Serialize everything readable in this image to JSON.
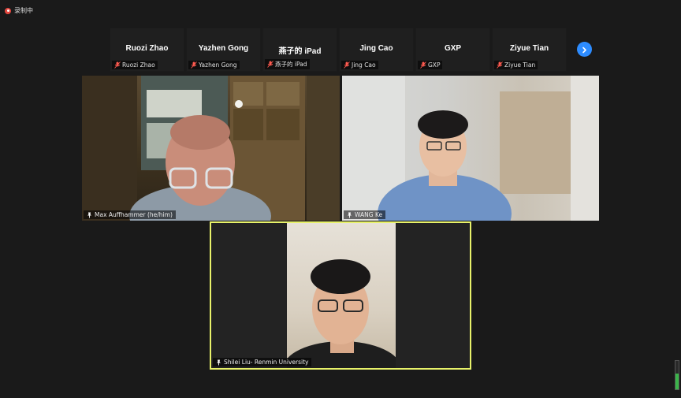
{
  "recording": {
    "label": "录制中"
  },
  "strip": {
    "tiles": [
      {
        "name": "Ruozi Zhao",
        "label": "Ruozi Zhao"
      },
      {
        "name": "Yazhen Gong",
        "label": "Yazhen Gong"
      },
      {
        "name": "燕子的 iPad",
        "label": "燕子的 iPad"
      },
      {
        "name": "Jing Cao",
        "label": "Jing Cao"
      },
      {
        "name": "GXP",
        "label": "GXP"
      },
      {
        "name": "Ziyue Tian",
        "label": "Ziyue Tian"
      }
    ]
  },
  "videos": {
    "v1": {
      "name": "Max Auffhammer (he/him)"
    },
    "v2": {
      "name": "WANG Ke"
    },
    "v3": {
      "name": "Shilei Liu- Renmin University"
    }
  },
  "colors": {
    "accent": "#2d8cff",
    "active_speaker": "#e8f26a",
    "muted": "#e5483f"
  },
  "icons": [
    "recording-icon",
    "mic-muted-icon",
    "chevron-right-icon",
    "pin-icon"
  ]
}
